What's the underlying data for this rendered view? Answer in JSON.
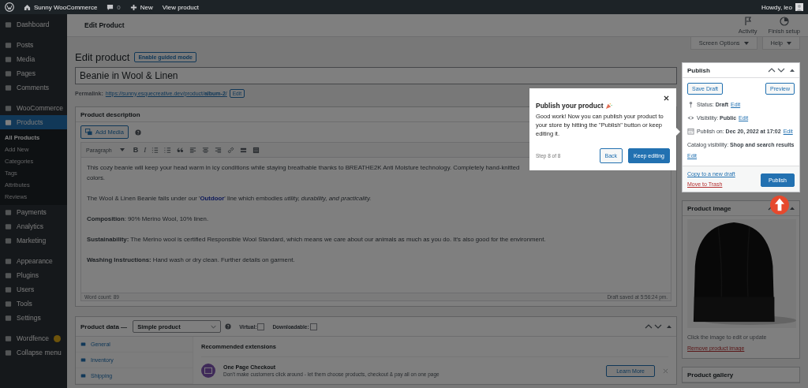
{
  "admin_bar": {
    "site": "Sunny WooCommerce",
    "comments": "0",
    "new": "New",
    "view": "View product",
    "howdy": "Howdy, leo"
  },
  "menu": [
    {
      "items": [
        {
          "label": "Dashboard",
          "selected": false
        }
      ]
    },
    {
      "items": [
        {
          "label": "Posts",
          "selected": false
        },
        {
          "label": "Media",
          "selected": false
        },
        {
          "label": "Pages",
          "selected": false
        },
        {
          "label": "Comments",
          "selected": false
        }
      ]
    },
    {
      "items": [
        {
          "label": "WooCommerce",
          "selected": false
        },
        {
          "label": "Products",
          "selected": true,
          "children": [
            {
              "label": "All Products",
              "selected": true
            },
            {
              "label": "Add New",
              "selected": false
            },
            {
              "label": "Categories",
              "selected": false
            },
            {
              "label": "Tags",
              "selected": false
            },
            {
              "label": "Attributes",
              "selected": false
            },
            {
              "label": "Reviews",
              "selected": false
            }
          ]
        },
        {
          "label": "Payments",
          "selected": false
        },
        {
          "label": "Analytics",
          "selected": false
        },
        {
          "label": "Marketing",
          "selected": false
        }
      ]
    },
    {
      "items": [
        {
          "label": "Appearance",
          "selected": false
        },
        {
          "label": "Plugins",
          "selected": false
        },
        {
          "label": "Users",
          "selected": false
        },
        {
          "label": "Tools",
          "selected": false
        },
        {
          "label": "Settings",
          "selected": false
        }
      ]
    },
    {
      "items": [
        {
          "label": "Wordfence",
          "selected": false,
          "notification": true
        },
        {
          "label": "Collapse menu",
          "selected": false
        }
      ]
    }
  ],
  "header": {
    "title": "Edit Product",
    "actions": [
      "Activity",
      "Finish setup"
    ]
  },
  "screen_tabs": [
    "Screen Options",
    "Help"
  ],
  "page_title": "Edit product",
  "guided_button": "Enable guided mode",
  "product_title": "Beanie in Wool & Linen",
  "permalink": {
    "label": "Permalink:",
    "url": "https://sunny.esquecreative.dev/product/**album-2**/",
    "edit": "Edit"
  },
  "description": {
    "title": "Product description",
    "add_media": "Add Media",
    "format": "Paragraph",
    "bold": "B",
    "italic": "I",
    "lines": [
      "This cozy beanie will keep your head warm in icy conditions while staying breathable thanks to BREATHE2K Anti Moisture technology. Completely hand-knitted",
      "colors."
    ],
    "line_with_link": {
      "before": "The Wool & Linen Beanie falls under our '",
      "link": "Outdoor",
      "after": "' line which embodies *utility, durability, and practicality.*"
    },
    "paragraphs": [
      "**Composition**: 90% Merino Wool, 10% linen.",
      "**Sustainability:** The Merino wool is certified Responsible Wool Standard, which means we care about our animals as much as you do. It's also good for the environment.",
      "**Washing Instructions:** Hand wash or dry clean. Further details on garment."
    ],
    "word_count": "Word count: 89",
    "draft_saved": "Draft saved at 5:56:24 pm."
  },
  "product_data": {
    "label": "Product data —",
    "type": "Simple product",
    "options": [
      {
        "label": "Virtual:",
        "checked": false
      },
      {
        "label": "Downloadable:",
        "checked": false
      }
    ],
    "tabs": [
      "General",
      "Inventory",
      "Shipping"
    ],
    "panel_title": "Recommended extensions",
    "extension": {
      "name": "One Page Checkout",
      "description": "Don't make customers click around - let them choose products, checkout & pay all on one page",
      "button": "Learn More"
    }
  },
  "publish": {
    "title": "Publish",
    "save_draft": "Save Draft",
    "preview": "Preview",
    "rows": [
      {
        "label": "Status:",
        "value": "Draft",
        "edit": "Edit"
      },
      {
        "label": "Visibility:",
        "value": "Public",
        "edit": "Edit"
      },
      {
        "label": "Publish on:",
        "value": "Dec 20, 2022 at 17:02",
        "edit": "Edit"
      },
      {
        "label": "Catalog visibility:",
        "value": "Shop and search results",
        "edit": "Edit"
      }
    ],
    "copy": "Copy to a new draft",
    "trash": "Move to Trash",
    "button": "Publish"
  },
  "tour": {
    "title": "Publish your product",
    "body": "Good work! Now you can publish your product to your store by hitting the \"Publish\" button or keep editing it.",
    "step": "Step 8 of 8",
    "back": "Back",
    "next": "Keep editing"
  },
  "product_image": {
    "title": "Product image",
    "hint": "Click the image to edit or update",
    "remove": "Remove product image"
  },
  "gallery_title": "Product gallery"
}
